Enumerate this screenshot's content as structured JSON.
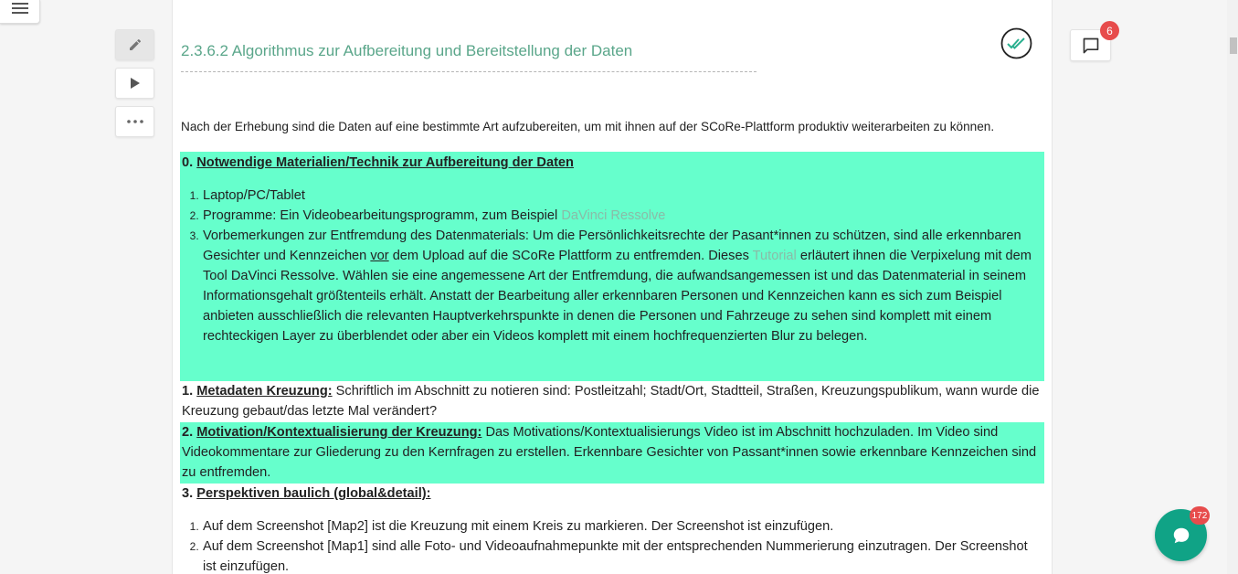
{
  "toolbar": {
    "menu_icon": "hamburger-icon",
    "edit_icon": "pencil-icon",
    "play_icon": "play-icon",
    "more_icon": "more-icon"
  },
  "section": {
    "title": "2.3.6.2 Algorithmus zur Aufbereitung und Bereitstellung der Daten",
    "status_icon": "double-check-icon",
    "intro": "Nach der Erhebung sind die Daten auf eine bestimmte Art aufzubereiten, um mit ihnen auf der SCoRe-Plattform produktiv weiterarbeiten zu können."
  },
  "blocks": {
    "b0": {
      "number": "0. ",
      "title": "Notwendige Materialien/Technik zur Aufbereitung der Daten",
      "items": {
        "i1": "Laptop/PC/Tablet",
        "i2_text": "Programme: Ein Videobearbeitungsprogramm, zum Beispiel ",
        "i2_link": "DaVinci Ressolve",
        "i3_a": "Vorbemerkungen zur Entfremdung des Datenmaterials: Um die Persönlichkeitsrechte der Pasant*innen zu schützen, sind alle erkennbaren Gesichter und Kennzeichen ",
        "i3_u": "vor",
        "i3_b": " dem Upload auf die SCoRe Plattform zu entfremden. Dieses ",
        "i3_link": "Tutorial",
        "i3_c": " erläutert ihnen die Verpixelung mit dem Tool DaVinci Ressolve. Wählen sie eine angemessene Art der Entfremdung, die aufwandsangemessen ist und das Datenmaterial in seinem Informationsgehalt größtenteils erhält. Anstatt der Bearbeitung aller erkennbaren Personen und Kennzeichen kann es sich zum Beispiel anbieten ausschließlich die relevanten Hauptverkehrspunkte in denen die Personen und Fahrzeuge zu sehen sind komplett mit einem rechteckigen Layer zu überblendet oder aber ein Videos komplett mit einem hochfrequenzierten Blur zu belegen."
      }
    },
    "b1": {
      "number": "1. ",
      "title": "Metadaten Kreuzung:",
      "text": " Schriftlich im Abschnitt zu notieren sind: Postleitzahl; Stadt/Ort, Stadtteil, Straßen, Kreuzungspublikum, wann wurde die Kreuzung gebaut/das letzte Mal verändert?"
    },
    "b2": {
      "number": "2. ",
      "title": "Motivation/Kontextualisierung der Kreuzung:",
      "text": " Das Motivations/Kontextualisierungs Video ist im Abschnitt hochzuladen. Im Video sind Videokommentare zur Gliederung zu den Kernfragen zu erstellen. Erkennbare Gesichter von Passant*innen sowie erkennbare Kennzeichen sind zu entfremden."
    },
    "b3": {
      "number": "3. ",
      "title": "Perspektiven baulich (global&detail):",
      "items": {
        "i1": "Auf dem Screenshot [Map2] ist die Kreuzung mit einem Kreis zu markieren. Der Screenshot ist einzufügen.",
        "i2": "Auf dem Screenshot [Map1] sind alle Foto- und Videoaufnahmepunkte mit der entsprechenden Nummerierung einzutragen. Der Screenshot ist einzufügen."
      }
    }
  },
  "comments": {
    "icon": "comment-icon",
    "count": "6"
  },
  "chat": {
    "icon": "chat-bubble-icon",
    "count": "172"
  },
  "colors": {
    "highlight": "#66ffcc",
    "heading": "#5aa68a",
    "link": "#8abba7",
    "chat": "#10a386",
    "badge": "#e74c4c"
  }
}
